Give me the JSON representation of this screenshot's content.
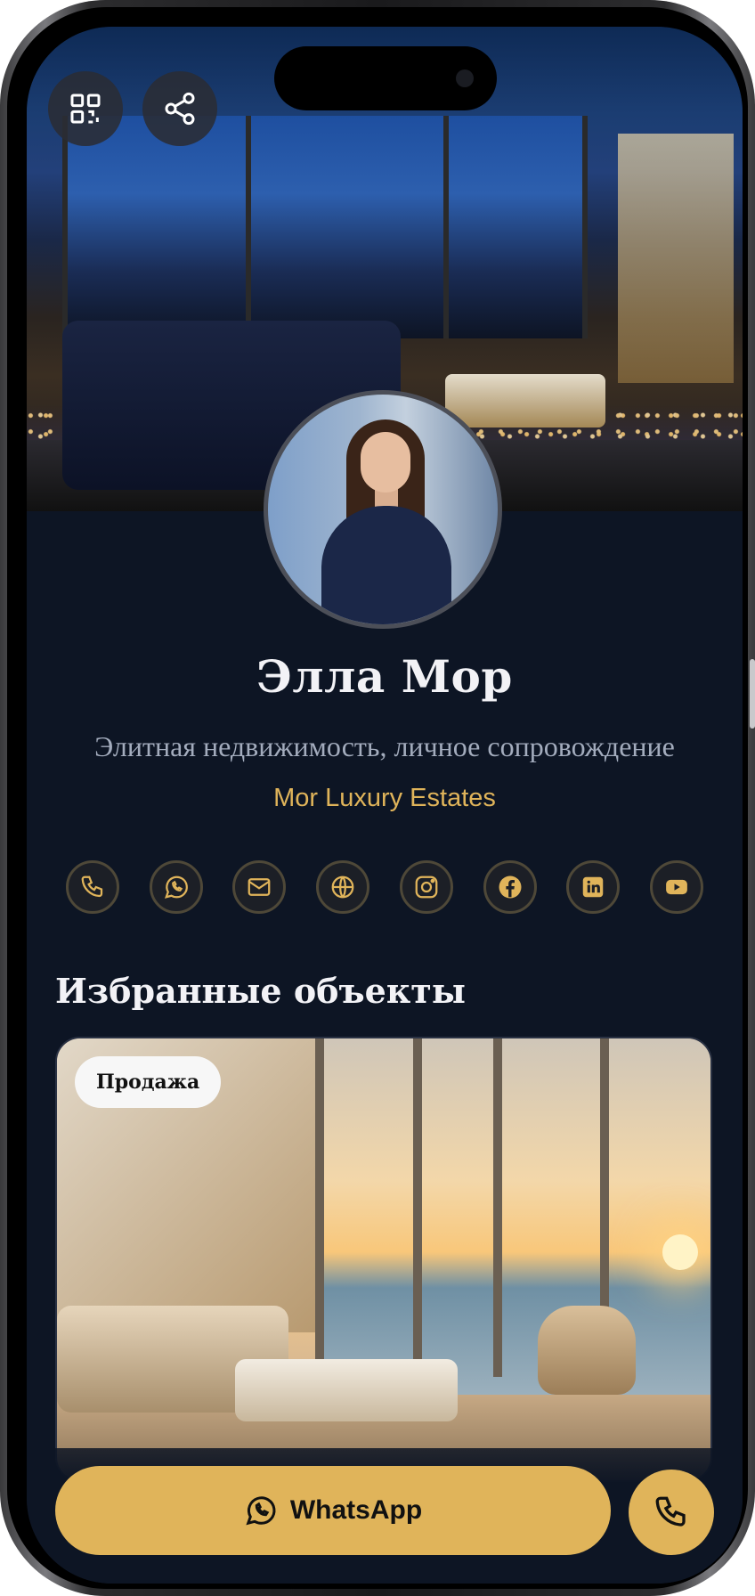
{
  "profile": {
    "name": "Элла Мор",
    "subtitle": "Элитная недвижимость, личное сопровождение",
    "company": "Mor Luxury Estates"
  },
  "header_actions": {
    "qr_icon": "qr-code-icon",
    "share_icon": "share-icon"
  },
  "socials": [
    {
      "icon": "phone-icon"
    },
    {
      "icon": "whatsapp-icon"
    },
    {
      "icon": "mail-icon"
    },
    {
      "icon": "globe-icon"
    },
    {
      "icon": "instagram-icon"
    },
    {
      "icon": "facebook-icon"
    },
    {
      "icon": "linkedin-icon"
    },
    {
      "icon": "youtube-icon"
    }
  ],
  "listings": {
    "title": "Избранные объекты",
    "items": [
      {
        "badge": "Продажа"
      }
    ]
  },
  "actions": {
    "whatsapp_label": "WhatsApp",
    "call_icon": "phone-icon"
  },
  "colors": {
    "background": "#0d1524",
    "accent": "#e0b45a",
    "text": "#f2f2f6",
    "muted": "#a3acbd"
  }
}
